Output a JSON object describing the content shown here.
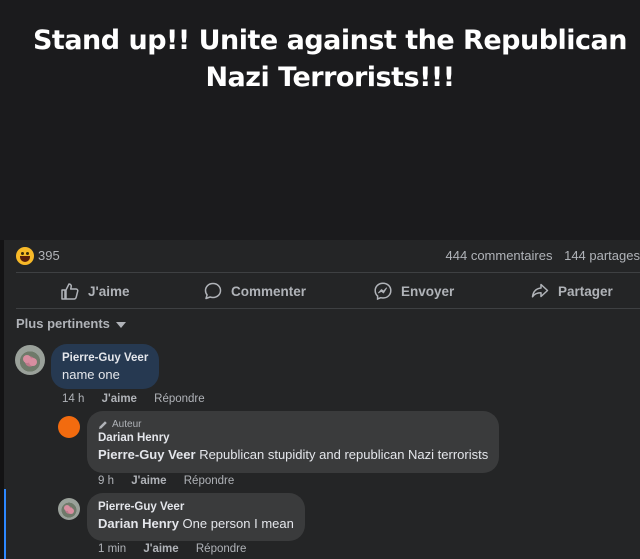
{
  "post": {
    "title": "Stand up!! Unite against the Republican Nazi Terrorists!!!"
  },
  "stats": {
    "reaction_count": "395",
    "comments": "444 commentaires",
    "shares": "144 partages"
  },
  "actions": {
    "like": "J'aime",
    "comment": "Commenter",
    "send": "Envoyer",
    "share": "Partager"
  },
  "sort_label": "Plus pertinents",
  "comments": [
    {
      "author": "Pierre-Guy Veer",
      "text": "name one",
      "time": "14 h",
      "like": "J'aime",
      "reply": "Répondre"
    },
    {
      "author_tag": "Auteur",
      "author": "Darian Henry",
      "mention": "Pierre-Guy Veer",
      "text": "Republican stupidity and republican Nazi terrorists",
      "time": "9 h",
      "like": "J'aime",
      "reply": "Répondre"
    },
    {
      "author": "Pierre-Guy Veer",
      "mention": "Darian Henry",
      "text": "One person I mean",
      "time": "1 min",
      "like": "J'aime",
      "reply": "Répondre"
    }
  ],
  "colors": {
    "panel": "#242526",
    "bubble": "#3a3b3c",
    "bubble_highlight": "#263951",
    "accent": "#2d88ff",
    "author_avatar": "#f26b0f"
  }
}
